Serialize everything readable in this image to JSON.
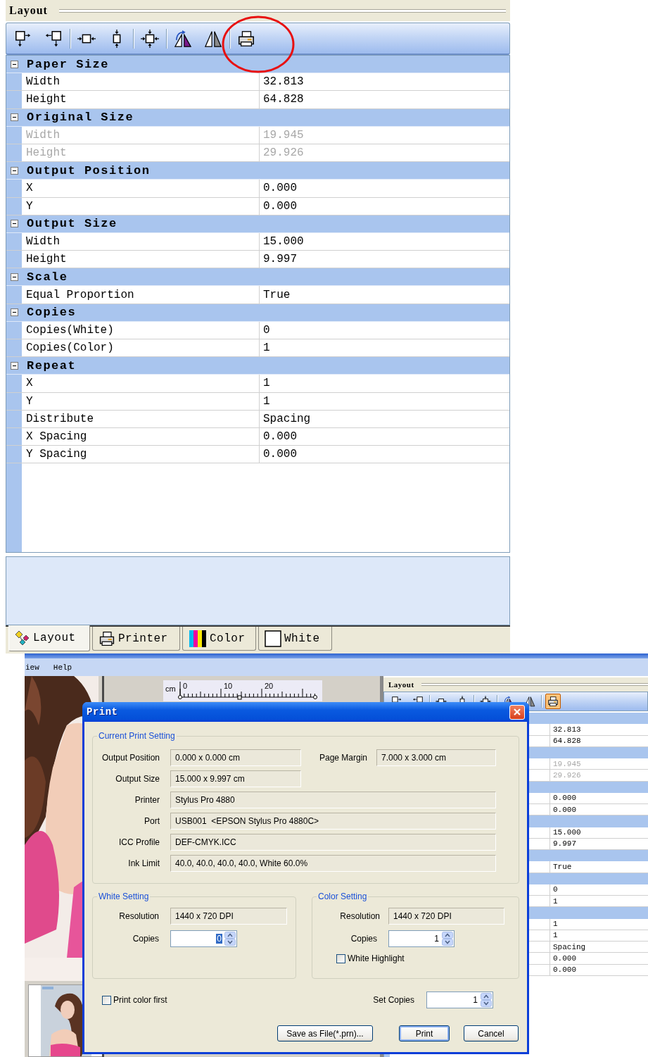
{
  "layout_panel": {
    "title": "Layout",
    "toolbar": [
      [
        {
          "kind": "expand-right",
          "selected": false
        },
        {
          "kind": "expand-left",
          "selected": false
        }
      ],
      [
        {
          "kind": "center-horizontal",
          "selected": false
        },
        {
          "kind": "center-vertical",
          "selected": false
        }
      ],
      [
        {
          "kind": "center-both",
          "selected": false
        }
      ],
      [
        {
          "kind": "flip-rotate",
          "selected": false
        },
        {
          "kind": "mirror",
          "selected": false
        }
      ],
      [
        {
          "kind": "print",
          "selected": false
        }
      ]
    ],
    "annotation": {
      "kind": "circle"
    },
    "sections": [
      {
        "title": "Paper Size",
        "expanded": true,
        "rows": [
          {
            "name": "Width",
            "value": "32.813",
            "disabled": false
          },
          {
            "name": "Height",
            "value": "64.828",
            "disabled": false
          }
        ]
      },
      {
        "title": "Original Size",
        "expanded": true,
        "rows": [
          {
            "name": "Width",
            "value": "19.945",
            "disabled": true
          },
          {
            "name": "Height",
            "value": "29.926",
            "disabled": true
          }
        ]
      },
      {
        "title": "Output Position",
        "expanded": true,
        "rows": [
          {
            "name": "X",
            "value": "0.000",
            "disabled": false
          },
          {
            "name": "Y",
            "value": "0.000",
            "disabled": false
          }
        ]
      },
      {
        "title": "Output Size",
        "expanded": true,
        "rows": [
          {
            "name": "Width",
            "value": "15.000",
            "disabled": false
          },
          {
            "name": "Height",
            "value": "9.997",
            "disabled": false
          }
        ]
      },
      {
        "title": "Scale",
        "expanded": true,
        "rows": [
          {
            "name": "Equal Proportion",
            "value": "True",
            "disabled": false
          }
        ]
      },
      {
        "title": "Copies",
        "expanded": true,
        "rows": [
          {
            "name": "Copies(White)",
            "value": "0",
            "disabled": false
          },
          {
            "name": "Copies(Color)",
            "value": "1",
            "disabled": false
          }
        ]
      },
      {
        "title": "Repeat",
        "expanded": true,
        "rows": [
          {
            "name": "X",
            "value": "1",
            "disabled": false
          },
          {
            "name": "Y",
            "value": "1",
            "disabled": false
          },
          {
            "name": "Distribute",
            "value": "Spacing",
            "disabled": false
          },
          {
            "name": "X Spacing",
            "value": "0.000",
            "disabled": false
          },
          {
            "name": "Y Spacing",
            "value": "0.000",
            "disabled": false
          }
        ]
      }
    ],
    "tabs": [
      {
        "label": "Layout",
        "kind": "layout",
        "selected": true
      },
      {
        "label": "Printer",
        "kind": "printer",
        "selected": false
      },
      {
        "label": "Color",
        "kind": "color",
        "selected": false
      },
      {
        "label": "White",
        "kind": "white",
        "selected": false
      }
    ]
  },
  "app_window": {
    "menu": [
      "iew",
      "Help"
    ],
    "photo": {
      "kind": "picture"
    },
    "thumbnail": {
      "kind": "picture"
    },
    "ruler": {
      "unit": "cm",
      "labels": [
        "0",
        "10",
        "20"
      ]
    },
    "layout_panel": {
      "title": "Layout",
      "toolbar": [
        [
          {
            "kind": "expand-right",
            "selected": false
          },
          {
            "kind": "expand-left",
            "selected": false
          }
        ],
        [
          {
            "kind": "center-horizontal",
            "selected": false
          },
          {
            "kind": "center-vertical",
            "selected": false
          }
        ],
        [
          {
            "kind": "center-both",
            "selected": false
          }
        ],
        [
          {
            "kind": "flip-rotate",
            "selected": false
          },
          {
            "kind": "mirror",
            "selected": false
          }
        ],
        [
          {
            "kind": "print",
            "selected": true
          }
        ]
      ],
      "rows": [
        {
          "kind": "header"
        },
        {
          "kind": "row",
          "value": "32.813",
          "disabled": false
        },
        {
          "kind": "row",
          "value": "64.828",
          "disabled": false
        },
        {
          "kind": "header"
        },
        {
          "kind": "row",
          "value": "19.945",
          "disabled": true
        },
        {
          "kind": "row",
          "value": "29.926",
          "disabled": true
        },
        {
          "kind": "header"
        },
        {
          "kind": "row",
          "value": "0.000",
          "disabled": false
        },
        {
          "kind": "row",
          "value": "0.000",
          "disabled": false
        },
        {
          "kind": "header"
        },
        {
          "kind": "row",
          "value": "15.000",
          "disabled": false
        },
        {
          "kind": "row",
          "value": "9.997",
          "disabled": false
        },
        {
          "kind": "header"
        },
        {
          "kind": "row",
          "value": "True",
          "disabled": false
        },
        {
          "kind": "header"
        },
        {
          "kind": "row",
          "value": "0",
          "disabled": false
        },
        {
          "kind": "row",
          "value": "1",
          "disabled": false
        },
        {
          "kind": "header"
        },
        {
          "kind": "row",
          "value": "1",
          "disabled": false
        },
        {
          "kind": "row",
          "value": "1",
          "disabled": false
        },
        {
          "kind": "row",
          "value": "Spacing",
          "disabled": false
        },
        {
          "kind": "row",
          "value": "0.000",
          "disabled": false
        },
        {
          "kind": "row",
          "value": "0.000",
          "disabled": false
        }
      ]
    }
  },
  "print_dialog": {
    "title": "Print",
    "current": {
      "legend": "Current Print Setting",
      "rows": [
        [
          {
            "label": "Output Position",
            "value": "0.000 x 0.000 cm"
          },
          {
            "label": "Page Margin",
            "value": "7.000 x 3.000 cm"
          }
        ],
        [
          {
            "label": "Output Size",
            "value": "15.000 x 9.997 cm"
          }
        ],
        [
          {
            "label": "Printer",
            "value": "Stylus Pro 4880"
          }
        ],
        [
          {
            "label": "Port",
            "value": "USB001  <EPSON Stylus Pro 4880C>"
          }
        ],
        [
          {
            "label": "ICC Profile",
            "value": "DEF-CMYK.ICC"
          }
        ],
        [
          {
            "label": "Ink Limit",
            "value": "40.0, 40.0, 40.0, 40.0, White 60.0%"
          }
        ]
      ]
    },
    "white": {
      "legend": "White Setting",
      "resolution": {
        "label": "Resolution",
        "value": "1440 x 720 DPI"
      },
      "copies": {
        "label": "Copies",
        "value": "0",
        "selected": true
      }
    },
    "color": {
      "legend": "Color Setting",
      "resolution": {
        "label": "Resolution",
        "value": "1440 x 720 DPI"
      },
      "copies": {
        "label": "Copies",
        "value": "1",
        "selected": false
      },
      "white_highlight": {
        "label": "White Highlight",
        "checked": false
      }
    },
    "print_color_first": {
      "label": "Print color first",
      "checked": false
    },
    "set_copies": {
      "label": "Set Copies",
      "value": "1",
      "selected": false
    },
    "buttons": [
      {
        "label": "Save as File(*.prn)...",
        "default": false
      },
      {
        "label": "Print",
        "default": true
      },
      {
        "label": "Cancel",
        "default": false
      }
    ]
  }
}
